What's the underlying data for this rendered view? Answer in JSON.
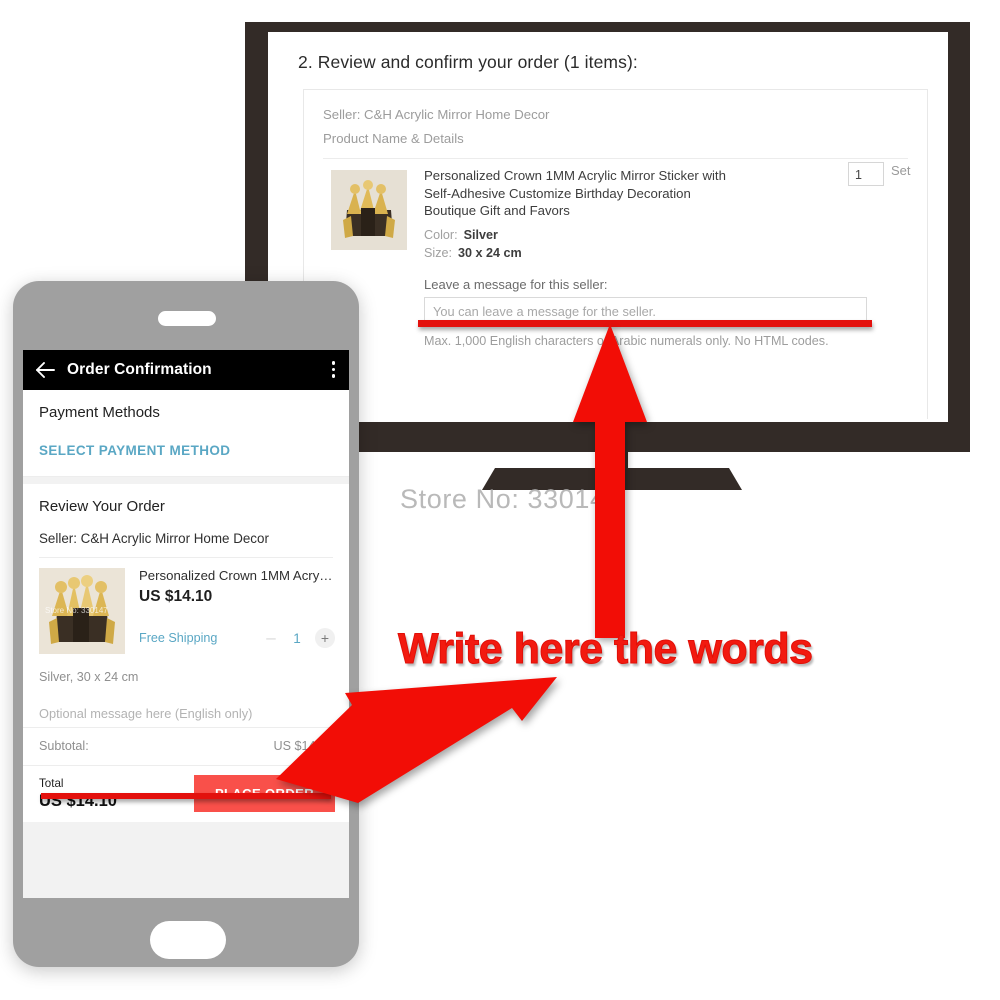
{
  "annotations": {
    "callout_text": "Write here the words",
    "callout_color": "#f21a10",
    "arrow_up_name": "red-arrow-up",
    "arrow_diag_name": "red-arrow-diagonal"
  },
  "watermark": {
    "store_label": "Store No: 330147"
  },
  "desktop": {
    "heading": "2. Review and confirm your order (1 items):",
    "seller_line": "Seller: C&H Acrylic Mirror Home Decor",
    "column_header": "Product Name & Details",
    "product": {
      "title": "Personalized Crown 1MM Acrylic Mirror Sticker with Self-Adhesive Customize Birthday Decoration Boutique Gift and Favors",
      "color_label": "Color:",
      "color_value": "Silver",
      "size_label": "Size:",
      "size_value": "30 x 24 cm",
      "quantity": "1",
      "unit": "Set"
    },
    "message": {
      "label": "Leave a message for this seller:",
      "placeholder": "You can leave a message for the seller.",
      "value": "",
      "note": "Max. 1,000 English characters or Arabic numerals only. No HTML codes."
    }
  },
  "phone": {
    "appbar": {
      "back_icon": "arrow-left-icon",
      "title": "Order Confirmation",
      "overflow_icon": "more-vertical-icon"
    },
    "payment": {
      "section_title": "Payment Methods",
      "select_action": "SELECT PAYMENT METHOD",
      "link_color": "#5aa7c4"
    },
    "review": {
      "section_title": "Review Your Order",
      "seller_line": "Seller: C&H Acrylic Mirror Home Decor",
      "item": {
        "name": "Personalized Crown 1MM Acrylic ...",
        "price": "US $14.10",
        "shipping": "Free Shipping",
        "qty_minus": "–",
        "qty_value": "1",
        "qty_plus": "+",
        "variant": "Silver, 30 x 24 cm",
        "thumb_watermark": "Store No: 330147"
      },
      "message_placeholder": "Optional message here (English only)",
      "message_value": ""
    },
    "totals": {
      "subtotal_label": "Subtotal:",
      "subtotal_value": "US $14.10",
      "total_label": "Total",
      "total_value": "US $14.10",
      "place_order_label": "PLACE ORDER",
      "place_order_color": "#f9504a"
    }
  }
}
